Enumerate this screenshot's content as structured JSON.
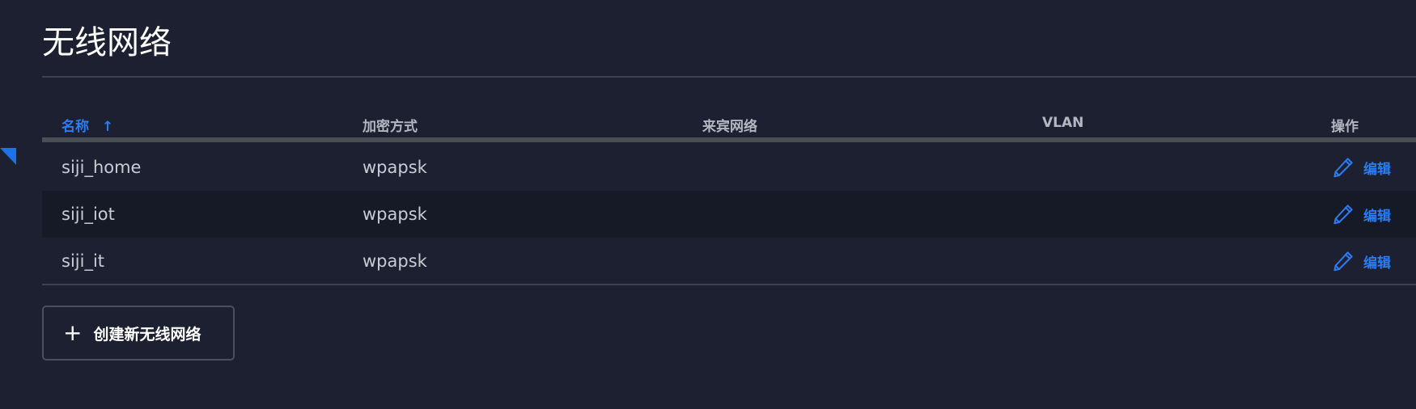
{
  "page": {
    "title": "无线网络"
  },
  "table": {
    "columns": {
      "name": "名称",
      "encryption": "加密方式",
      "guest_network": "来宾网络",
      "vlan": "VLAN",
      "actions": "操作"
    },
    "sort": {
      "column": "name",
      "direction": "ascending",
      "indicator": "↑"
    },
    "rows": [
      {
        "name": "siji_home",
        "encryption": "wpapsk",
        "guest_network": "",
        "vlan": "",
        "action_label": "编辑",
        "action_icon": "pencil-icon"
      },
      {
        "name": "siji_iot",
        "encryption": "wpapsk",
        "guest_network": "",
        "vlan": "",
        "action_label": "编辑",
        "action_icon": "pencil-icon"
      },
      {
        "name": "siji_it",
        "encryption": "wpapsk",
        "guest_network": "",
        "vlan": "",
        "action_label": "编辑",
        "action_icon": "pencil-icon"
      }
    ]
  },
  "create_button": {
    "icon": "plus-icon",
    "icon_glyph": "+",
    "label": "创建新无线网络"
  },
  "colors": {
    "background": "#1d2030",
    "row_alt": "#161926",
    "accent": "#2d7cf0",
    "text": "#c9ccd4",
    "title": "#ffffff"
  }
}
